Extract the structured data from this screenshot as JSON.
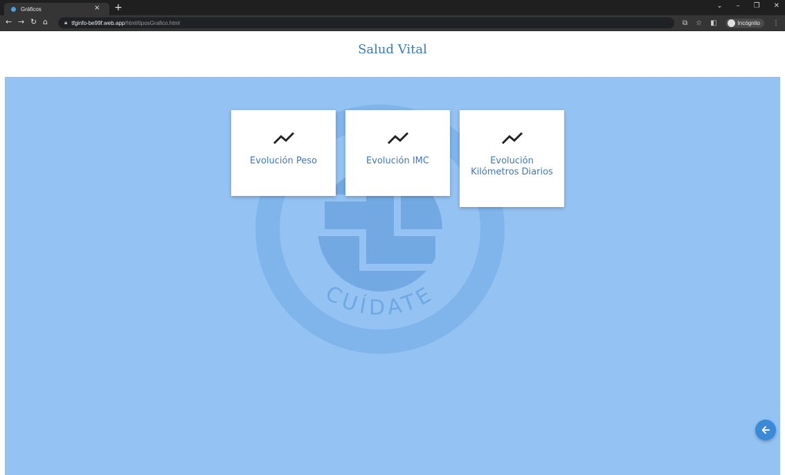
{
  "browser": {
    "tab_title": "Gráficos",
    "tab_close": "×",
    "new_tab": "+",
    "url_host": "tfginfo-be99f.web.app",
    "url_path": "/html/tiposGrafico.html",
    "incognito_label": "Incógnito"
  },
  "page": {
    "title": "Salud Vital"
  },
  "cards": [
    {
      "label": "Evolución Peso",
      "icon": "trending-line-icon"
    },
    {
      "label": "Evolución IMC",
      "icon": "trending-line-icon"
    },
    {
      "label_line1": "Evolución",
      "label_line2": "Kilómetros Diarios",
      "icon": "trending-line-icon"
    }
  ],
  "watermark": {
    "text_bottom": "CUÍDATE"
  },
  "fab": {
    "icon": "arrow-left-icon"
  },
  "colors": {
    "background": "#93c2f3",
    "accent": "#3b79b8",
    "fab": "#3b8ad9",
    "watermark": "#6fa8e3"
  }
}
